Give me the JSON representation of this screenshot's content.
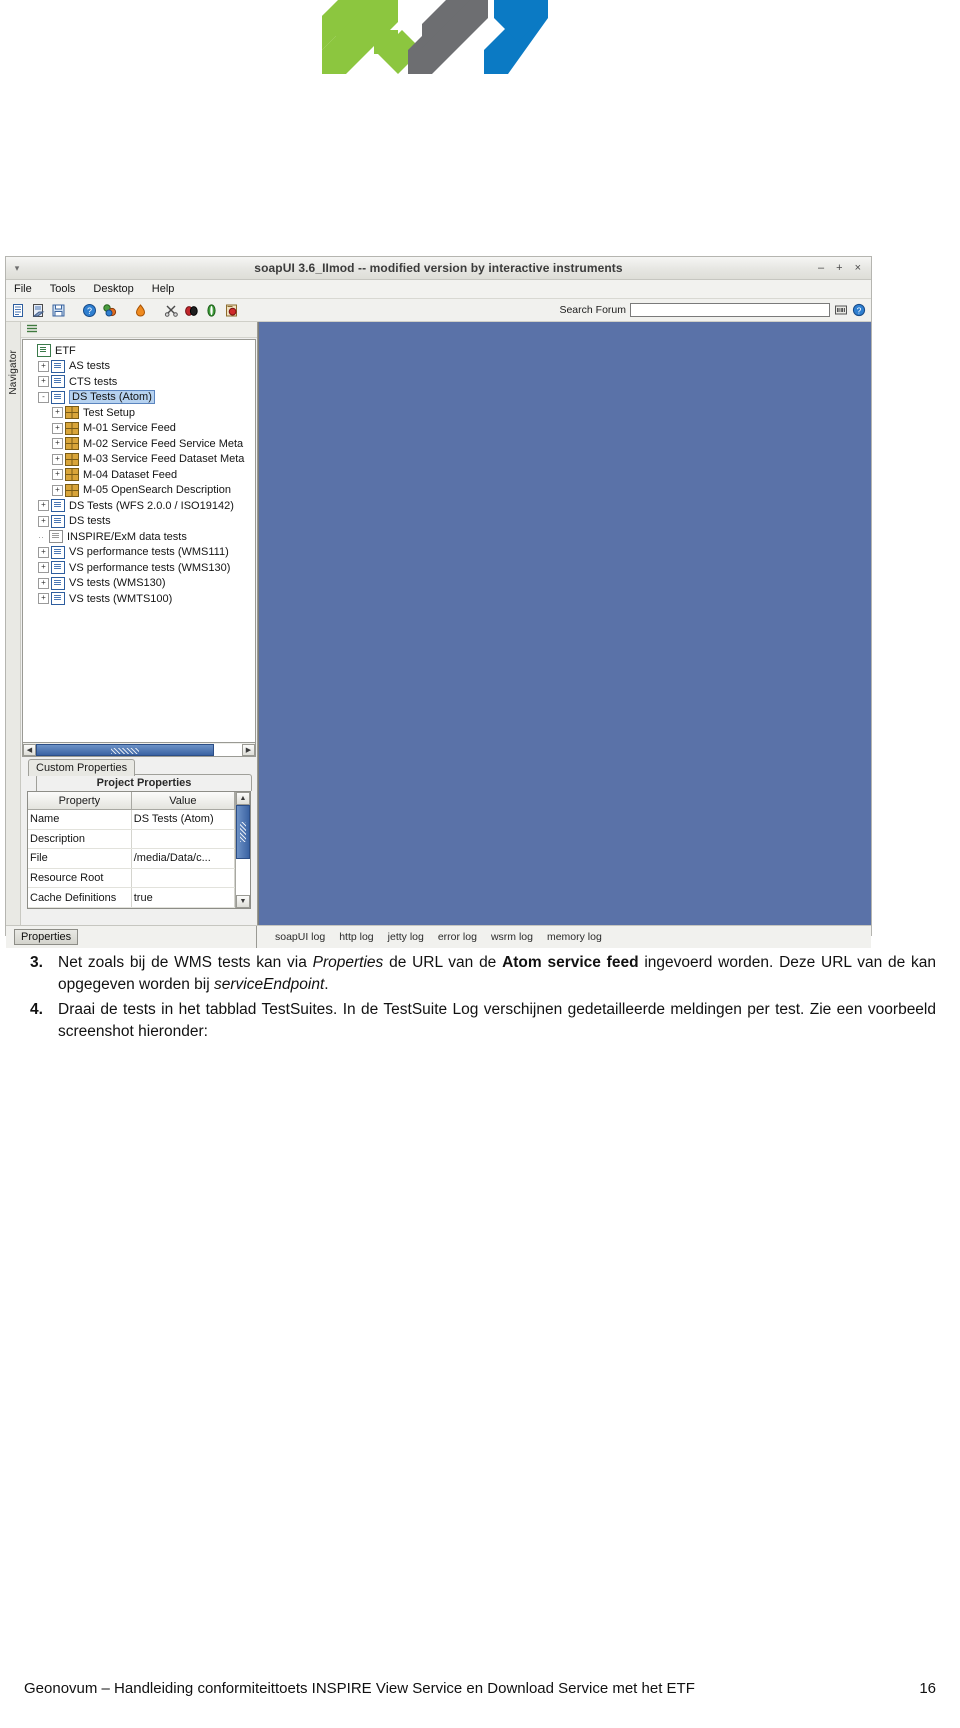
{
  "logo": {
    "name": "geonovum-logo",
    "colors": {
      "green": "#8cc63f",
      "gray": "#6d6e71",
      "blue": "#0b7ac4"
    }
  },
  "app": {
    "title": "soapUI 3.6_IImod -- modified version by interactive instruments",
    "window_controls": {
      "minimize": "–",
      "maximize": "+",
      "close": "×"
    },
    "titlebar_arrow": "▾",
    "menubar": [
      {
        "label": "File",
        "name": "menu-file"
      },
      {
        "label": "Tools",
        "name": "menu-tools"
      },
      {
        "label": "Desktop",
        "name": "menu-desktop"
      },
      {
        "label": "Help",
        "name": "menu-help"
      }
    ],
    "toolbar": {
      "icons": [
        "new-project-icon",
        "import-project-icon",
        "save-all-icon",
        "help-icon",
        "forum-icon",
        "trial-icon",
        "preferences-icon",
        "proxy-icon",
        "load-ui-icon",
        "bug-icon"
      ],
      "search_label": "Search Forum",
      "search_value": "",
      "search_placeholder": "",
      "right_icons": [
        "search-forum-go-icon",
        "forum-help-icon"
      ]
    },
    "navigator_strip": {
      "label": "Navigator"
    },
    "tree_toolbar": {
      "icon": "tree-options-icon"
    },
    "tree": {
      "items": [
        {
          "label": "ETF",
          "level": 0,
          "icon": "workspace-icon",
          "expander": "",
          "selected": false
        },
        {
          "label": "AS tests",
          "level": 1,
          "icon": "project-icon",
          "expander": "+",
          "selected": false
        },
        {
          "label": "CTS tests",
          "level": 1,
          "icon": "project-icon",
          "expander": "+",
          "selected": false
        },
        {
          "label": "DS Tests (Atom)",
          "level": 1,
          "icon": "project-icon",
          "expander": "-",
          "selected": true
        },
        {
          "label": "Test Setup",
          "level": 2,
          "icon": "testsuite-icon",
          "expander": "+",
          "selected": false
        },
        {
          "label": "M-01 Service Feed",
          "level": 2,
          "icon": "testsuite-icon",
          "expander": "+",
          "selected": false
        },
        {
          "label": "M-02 Service Feed Service Meta",
          "level": 2,
          "icon": "testsuite-icon",
          "expander": "+",
          "selected": false
        },
        {
          "label": "M-03 Service Feed Dataset Meta",
          "level": 2,
          "icon": "testsuite-icon",
          "expander": "+",
          "selected": false
        },
        {
          "label": "M-04 Dataset Feed",
          "level": 2,
          "icon": "testsuite-icon",
          "expander": "+",
          "selected": false
        },
        {
          "label": "M-05 OpenSearch Description",
          "level": 2,
          "icon": "testsuite-icon",
          "expander": "+",
          "selected": false
        },
        {
          "label": "DS Tests (WFS 2.0.0 / ISO19142)",
          "level": 1,
          "icon": "project-icon",
          "expander": "+",
          "selected": false
        },
        {
          "label": "DS tests",
          "level": 1,
          "icon": "project-icon",
          "expander": "+",
          "selected": false
        },
        {
          "label": "INSPIRE/ExM data tests",
          "level": 1,
          "icon": "project-closed-icon",
          "expander": "",
          "selected": false
        },
        {
          "label": "VS performance tests (WMS111)",
          "level": 1,
          "icon": "project-icon",
          "expander": "+",
          "selected": false
        },
        {
          "label": "VS performance tests (WMS130)",
          "level": 1,
          "icon": "project-icon",
          "expander": "+",
          "selected": false
        },
        {
          "label": "VS tests (WMS130)",
          "level": 1,
          "icon": "project-icon",
          "expander": "+",
          "selected": false
        },
        {
          "label": "VS tests (WMTS100)",
          "level": 1,
          "icon": "project-icon",
          "expander": "+",
          "selected": false
        }
      ]
    },
    "properties_panel": {
      "tabs": [
        {
          "label": "Custom Properties",
          "name": "tab-custom-properties",
          "active": false
        },
        {
          "label": "Project Properties",
          "name": "tab-project-properties",
          "active": true
        }
      ],
      "columns": [
        "Property",
        "Value"
      ],
      "rows": [
        {
          "property": "Name",
          "value": "DS Tests (Atom)"
        },
        {
          "property": "Description",
          "value": ""
        },
        {
          "property": "File",
          "value": "/media/Data/c..."
        },
        {
          "property": "Resource Root",
          "value": ""
        },
        {
          "property": "Cache Definitions",
          "value": "true"
        }
      ]
    },
    "statusbar": {
      "properties_button": "Properties",
      "log_tabs": [
        "soapUI log",
        "http log",
        "jetty log",
        "error log",
        "wsrm log",
        "memory log"
      ]
    }
  },
  "document": {
    "items": [
      {
        "number": "3.",
        "segments": [
          {
            "t": "Net zoals bij de WMS tests kan via ",
            "s": ""
          },
          {
            "t": "Properties",
            "s": "it"
          },
          {
            "t": " de URL van de ",
            "s": ""
          },
          {
            "t": "Atom service feed",
            "s": "bd"
          },
          {
            "t": " ingevoerd worden. Deze URL van de kan opgegeven worden bij ",
            "s": ""
          },
          {
            "t": "serviceEndpoint",
            "s": "it"
          },
          {
            "t": ".",
            "s": ""
          }
        ]
      },
      {
        "number": "4.",
        "segments": [
          {
            "t": "Draai de tests in het tabblad TestSuites. In de TestSuite Log verschijnen gedetailleerde meldingen per test. Zie een voorbeeld screenshot hieronder:",
            "s": ""
          }
        ]
      }
    ]
  },
  "footer": {
    "text": "Geonovum – Handleiding conformiteittoets INSPIRE View Service en Download Service met het ETF",
    "page": "16"
  }
}
